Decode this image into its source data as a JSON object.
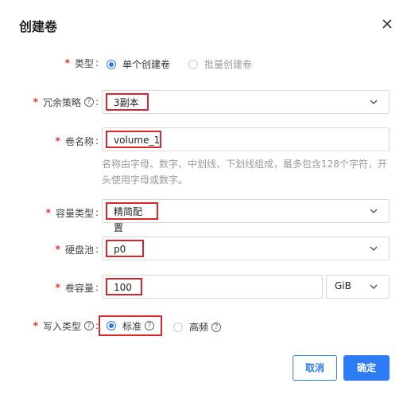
{
  "dialog": {
    "title": "创建卷"
  },
  "form": {
    "type": {
      "label": "类型",
      "options": [
        "单个创建卷",
        "批量创建卷"
      ],
      "selected": "单个创建卷"
    },
    "redundancy": {
      "label": "冗余策略",
      "value": "3副本"
    },
    "name": {
      "label": "卷名称",
      "value": "volume_1",
      "hint": "名称由字母、数字、中划线、下划线组成，最多包含128个字符，开头使用字母或数字。"
    },
    "capacity_type": {
      "label": "容量类型",
      "value": "精简配置"
    },
    "pool": {
      "label": "硬盘池",
      "value": "p0"
    },
    "capacity": {
      "label": "卷容量",
      "value": "100",
      "unit": "GiB"
    },
    "write_type": {
      "label": "写入类型",
      "options": [
        "标准",
        "高频"
      ],
      "selected": "标准"
    }
  },
  "buttons": {
    "cancel": "取消",
    "ok": "确定"
  },
  "colors": {
    "accent": "#2d7cf6",
    "required": "#e5322d",
    "highlight": "#d9252b"
  }
}
